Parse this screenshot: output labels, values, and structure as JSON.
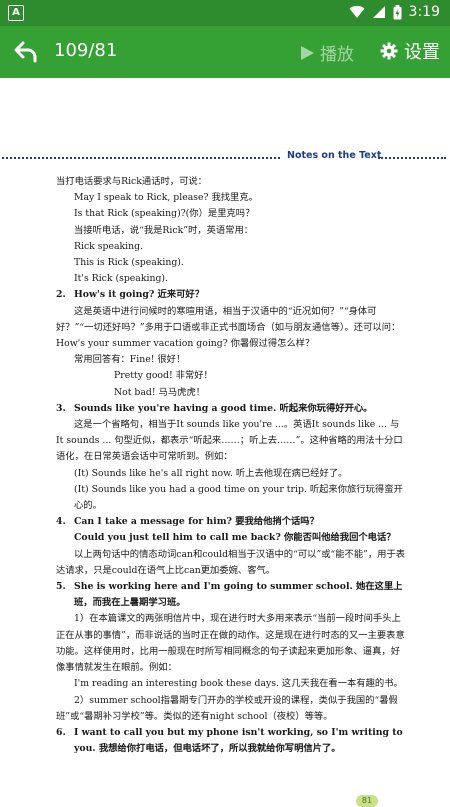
{
  "status_bar": {
    "left_icon": "A",
    "time": "3:19",
    "icons": [
      "wifi-icon",
      "signal-icon",
      "battery-icon"
    ]
  },
  "toolbar": {
    "page_count": "109/81",
    "play_label": "播放",
    "settings_label": "设置"
  },
  "notes": {
    "header": "Notes on the Text",
    "lines": [
      {
        "style": "para",
        "text": "当打电话要求与Rick通话时，可说："
      },
      {
        "style": "indent1",
        "text": "May I speak to Rick, please? 我找里克。"
      },
      {
        "style": "indent1",
        "text": "Is that Rick (speaking)?(你）是里克吗？"
      },
      {
        "style": "indent1",
        "text": "当接听电话，说“我是Rick”时，英语常用："
      },
      {
        "style": "indent1",
        "text": "Rick speaking."
      },
      {
        "style": "indent1",
        "text": "This is Rick (speaking)."
      },
      {
        "style": "indent1",
        "text": "It's Rick (speaking)."
      },
      {
        "style": "numbered",
        "num": "2.",
        "text": "How's it going? 近来可好？"
      },
      {
        "style": "indent-text",
        "text": "这是英语中进行问候时的寒暄用语，相当于汉语中的“近况如何？”“身体可好？”“一切还好吗？”多用于口语或非正式书面场合（如与朋友通信等）。还可以问：How's your summer vacation going? 你暑假过得怎么样？"
      },
      {
        "style": "indent1",
        "text": "常用回答有：Fine! 很好！"
      },
      {
        "style": "indent2",
        "text": "Pretty good! 非常好！"
      },
      {
        "style": "indent2",
        "text": "Not bad! 马马虎虎！"
      },
      {
        "style": "numbered",
        "num": "3.",
        "text": "Sounds like you're having a good time. 听起来你玩得好开心。"
      },
      {
        "style": "indent-text",
        "text": "这是一个省略句，相当于It sounds like you're ...。英语It sounds like ... 与It sounds ... 句型近似，都表示“听起来……；听上去……”。这种省略的用法十分口语化，在日常英语会话中可常听到。例如："
      },
      {
        "style": "indent1",
        "text": "(It) Sounds like he's all right now. 听上去他现在病已经好了。"
      },
      {
        "style": "indent1",
        "text": "(It) Sounds like you had a good time on your trip. 听起来你旅行玩得蛮开心的。"
      },
      {
        "style": "numbered",
        "num": "4.",
        "text": "Can I take a message for him? 要我给他捎个话吗？"
      },
      {
        "style": "numbered-cont",
        "text": "Could you just tell him to call me back? 你能否叫他给我回个电话？"
      },
      {
        "style": "indent-text",
        "text": "以上两句话中的情态动词can和could相当于汉语中的“可以”或“能不能”，用于表达请求，只是could在语气上比can更加委婉、客气。"
      },
      {
        "style": "numbered",
        "num": "5.",
        "text": "She is working here and I'm going to summer school. 她在这里上班，而我在上暑期学习班。"
      },
      {
        "style": "indent-text",
        "text": "1）在本篇课文的两张明信片中，现在进行时大多用来表示“当前一段时间手头上正在从事的事情”，而非说话的当时正在做的动作。这是现在进行时态的又一主要表意功能。这样使用时，比用一般现在时所写相同概念的句子读起来更加形象、逼真，好像事情就发生在眼前。例如："
      },
      {
        "style": "indent1",
        "text": "I'm reading an interesting book these days. 这几天我在看一本有趣的书。"
      },
      {
        "style": "indent-text",
        "text": "2）summer school指暑期专门开办的学校或开设的课程，类似于我国的“暑假班”或“暑期补习学校”等。类似的还有night school（夜校）等等。"
      },
      {
        "style": "numbered",
        "num": "6.",
        "text": "I want to call you but my phone isn't working, so I'm writing to you. 我想给你打电话，但电话坏了，所以我就给你写明信片了。"
      }
    ],
    "page_number": "81"
  }
}
